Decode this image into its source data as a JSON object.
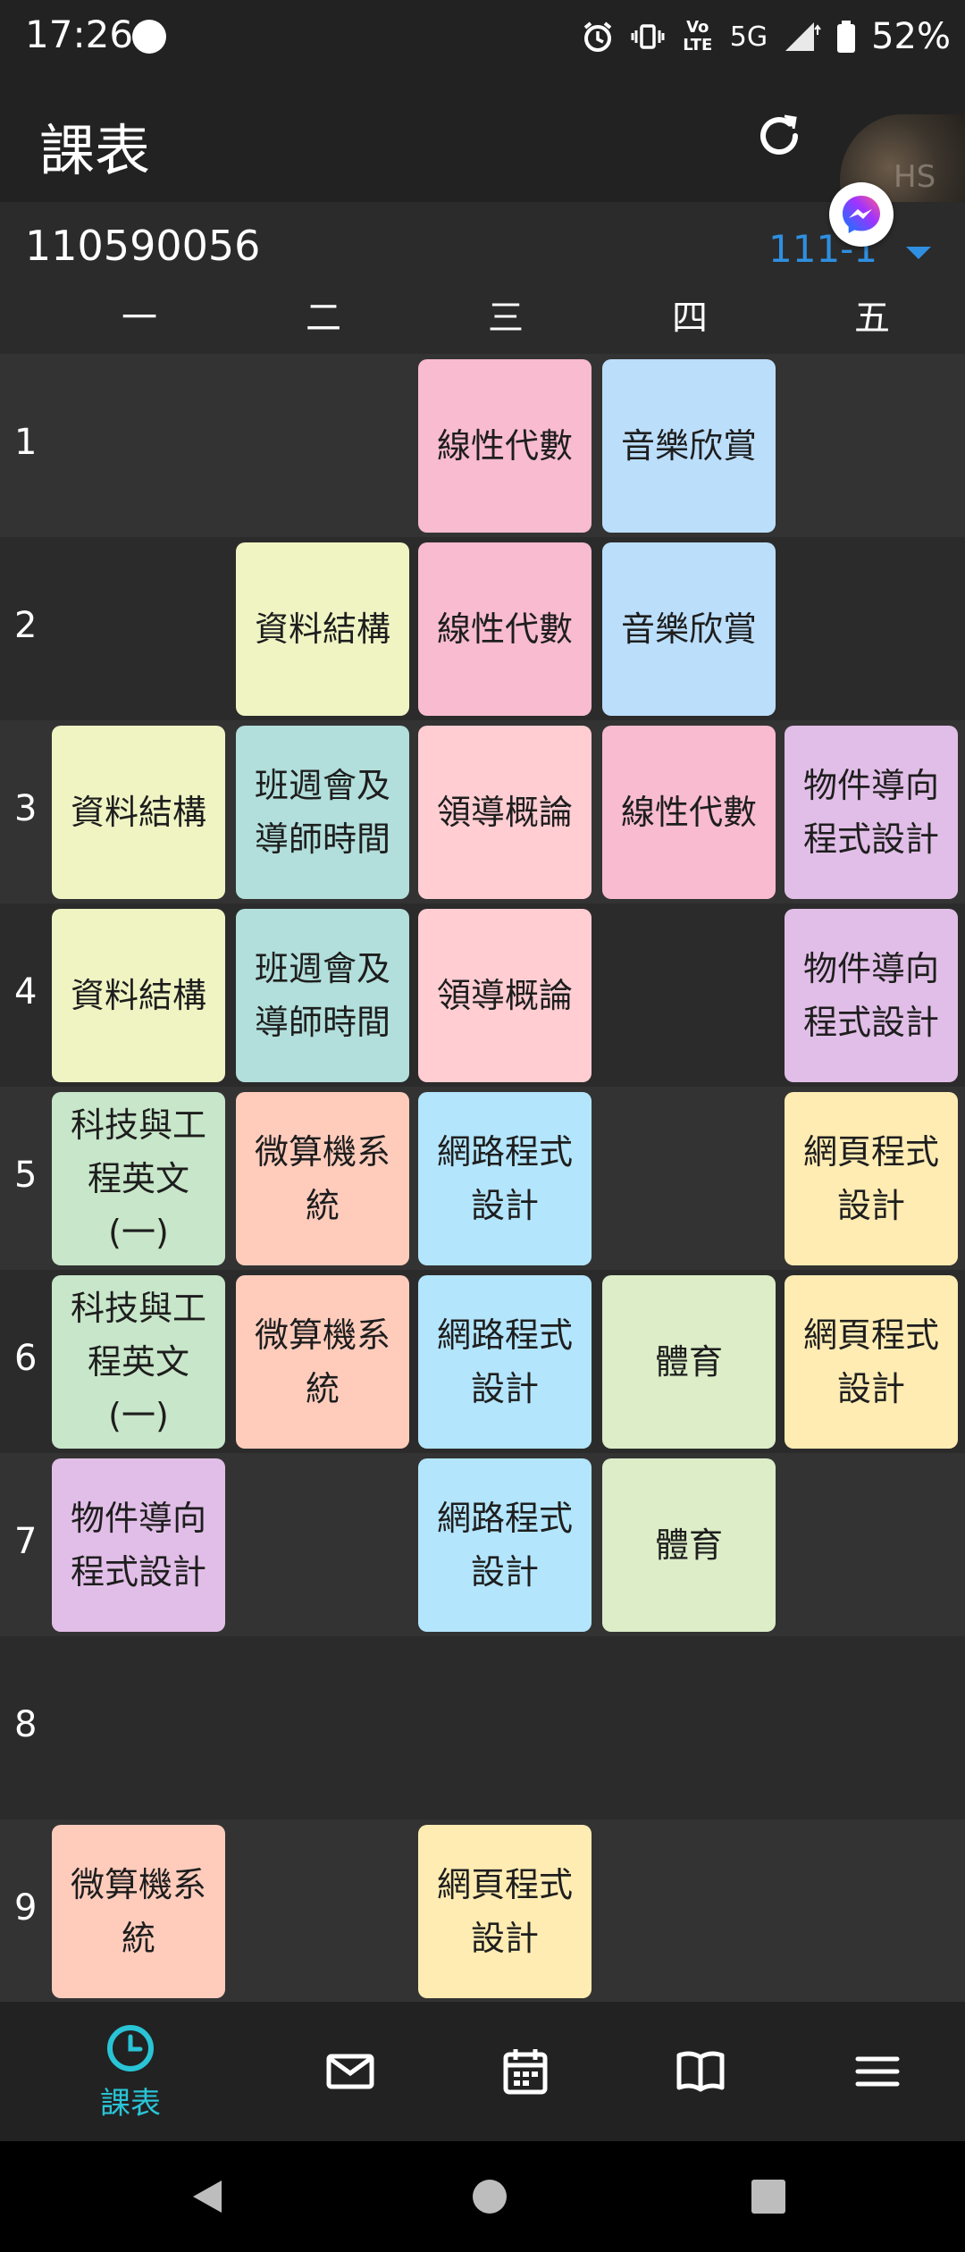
{
  "status": {
    "time": "17:26",
    "battery": "52%",
    "network": "5G",
    "volte": "Vo LTE"
  },
  "appbar": {
    "title": "課表",
    "refresh_icon": "refresh-icon",
    "avatar_text": "HS"
  },
  "info": {
    "student_id": "110590056",
    "semester": "111-1"
  },
  "days": [
    "一",
    "二",
    "三",
    "四",
    "五"
  ],
  "periods": [
    "1",
    "2",
    "3",
    "4",
    "5",
    "6",
    "7",
    "8",
    "9"
  ],
  "colors": {
    "linear_algebra": "#f8bbd0",
    "music": "#bbdefb",
    "data_structure": "#f0f4c3",
    "class_meeting": "#b2dfdb",
    "leadership": "#ffcdd2",
    "oop": "#e1bee7",
    "tech_english": "#c8e6c9",
    "microcomputer": "#ffccbc",
    "network_prog": "#b3e5fc",
    "web_prog": "#ffecb3",
    "pe": "#dcedc8"
  },
  "courses": {
    "r1_c3": "線性代數",
    "r1_c4": "音樂欣賞",
    "r2_c2": "資料結構",
    "r2_c3": "線性代數",
    "r2_c4": "音樂欣賞",
    "r3_c1": "資料結構",
    "r3_c2": "班週會及導師時間",
    "r3_c3": "領導概論",
    "r3_c4": "線性代數",
    "r3_c5": "物件導向程式設計",
    "r4_c1": "資料結構",
    "r4_c2": "班週會及導師時間",
    "r4_c3": "領導概論",
    "r4_c5": "物件導向程式設計",
    "r5_c1": "科技與工程英文(一)",
    "r5_c2": "微算機系統",
    "r5_c3": "網路程式設計",
    "r5_c5": "網頁程式設計",
    "r6_c1": "科技與工程英文(一)",
    "r6_c2": "微算機系統",
    "r6_c3": "網路程式設計",
    "r6_c4": "體育",
    "r6_c5": "網頁程式設計",
    "r7_c1": "物件導向程式設計",
    "r7_c3": "網路程式設計",
    "r7_c4": "體育",
    "r9_c1": "微算機系統",
    "r9_c3": "網頁程式設計"
  },
  "bottom_nav": {
    "schedule_label": "課表",
    "icons": [
      "clock-icon",
      "mail-icon",
      "calendar-icon",
      "book-icon",
      "menu-icon"
    ]
  }
}
